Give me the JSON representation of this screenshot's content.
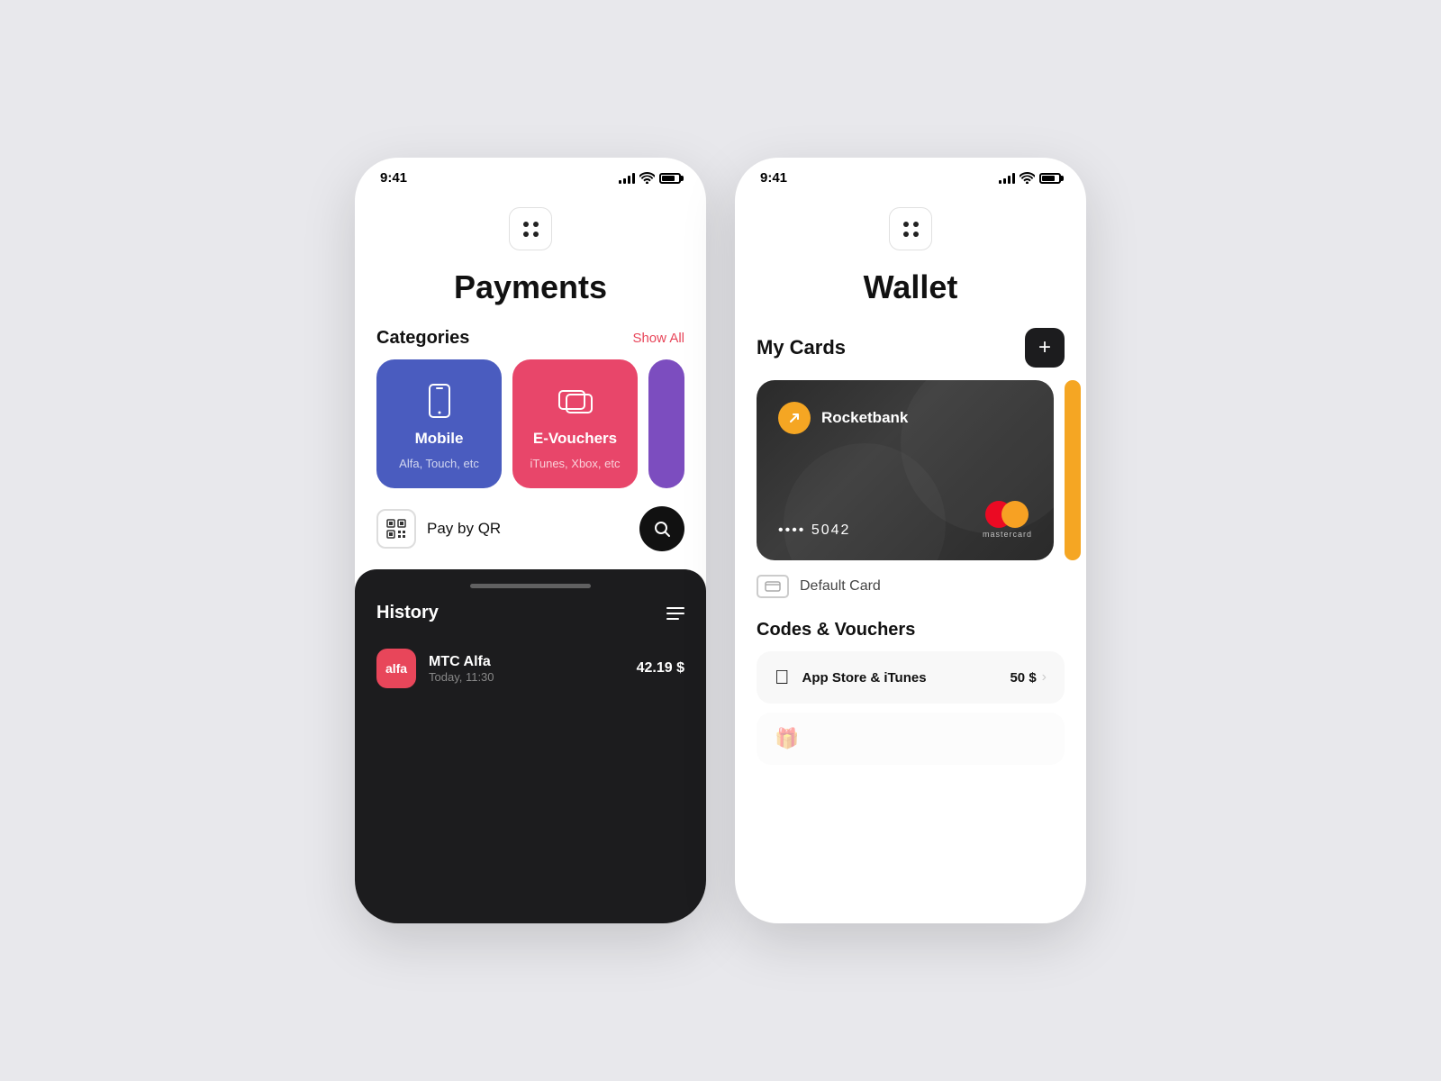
{
  "payments": {
    "status_time": "9:41",
    "grid_btn_label": "grid",
    "title": "Payments",
    "categories_label": "Categories",
    "show_all_label": "Show All",
    "categories": [
      {
        "id": "mobile",
        "label": "Mobile",
        "sublabel": "Alfa, Touch, etc",
        "color": "blue"
      },
      {
        "id": "evouchers",
        "label": "E-Vouchers",
        "sublabel": "iTunes, Xbox, etc",
        "color": "pink"
      }
    ],
    "pay_qr_label": "Pay by QR",
    "history_label": "History",
    "history_items": [
      {
        "avatar_text": "alfa",
        "name": "MTC Alfa",
        "date": "Today, 11:30",
        "amount": "42.19 $"
      }
    ]
  },
  "wallet": {
    "status_time": "9:41",
    "title": "Wallet",
    "my_cards_label": "My Cards",
    "add_btn_label": "+",
    "card": {
      "bank_name": "Rocketbank",
      "number_masked": "•••• 5042",
      "network": "mastercard"
    },
    "default_card_label": "Default Card",
    "codes_vouchers_label": "Codes & Vouchers",
    "vouchers": [
      {
        "icon": "apple",
        "name": "App Store & iTunes",
        "amount": "50 $"
      }
    ]
  }
}
